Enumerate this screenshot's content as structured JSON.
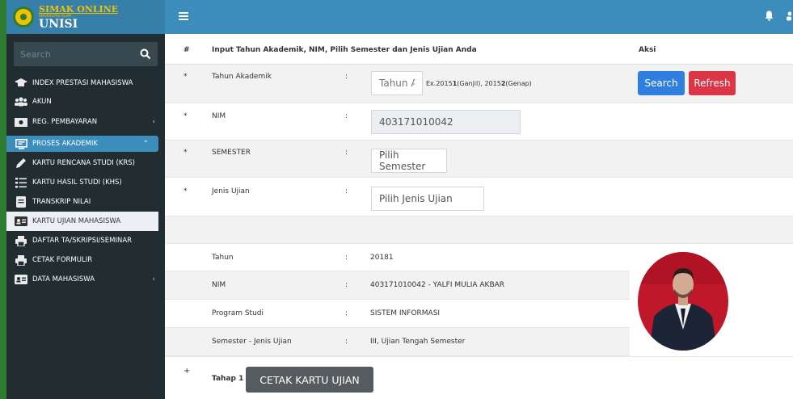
{
  "app": {
    "logo_top": "SIMAK ONLINE",
    "logo_subtitle": "UNIVERSITAS ISLAM ...",
    "logo_bottom": "UNISI"
  },
  "sidebar": {
    "search_placeholder": "Search",
    "items": [
      {
        "label": "INDEX PRESTASI MAHASISWA",
        "icon": "graduation-cap-icon"
      },
      {
        "label": "AKUN",
        "icon": "users-icon"
      },
      {
        "label": "REG. PEMBAYARAN",
        "icon": "money-icon",
        "arrow": "‹"
      },
      {
        "label": "PROSES AKADEMIK",
        "icon": "monitor-icon",
        "arrow": "⌄"
      }
    ],
    "submenu": [
      {
        "label": "KARTU RENCANA STUDI (KRS)",
        "icon": "pencil-icon"
      },
      {
        "label": "KARTU HASIL STUDI (KHS)",
        "icon": "list-icon"
      },
      {
        "label": "TRANSKRIP NILAI",
        "icon": "document-icon"
      },
      {
        "label": "KARTU UJIAN MAHASISWA",
        "icon": "id-card-icon"
      },
      {
        "label": "DAFTAR TA/SKRIPSI/SEMINAR",
        "icon": "printer-icon"
      },
      {
        "label": "CETAK FORMULIR",
        "icon": "printer-icon"
      }
    ],
    "last": {
      "label": "DATA MAHASISWA",
      "icon": "id-card-icon",
      "arrow": "‹"
    }
  },
  "table": {
    "header": {
      "num": "#",
      "title": "Input Tahun Akademik, NIM, Pilih Semester dan Jenis Ujian Anda",
      "action": "Aksi"
    },
    "rows": {
      "tahun_akademik": {
        "marker": "*",
        "label": "Tahun Akademik",
        "sep": ":",
        "placeholder": "Tahun Ak"
      },
      "nim": {
        "marker": "*",
        "label": "NIM",
        "sep": ":",
        "value": "403171010042"
      },
      "semester": {
        "marker": "*",
        "label": "SEMESTER",
        "sep": ":",
        "value": "Pilih Semester"
      },
      "jenis_ujian": {
        "marker": "*",
        "label": "Jenis Ujian",
        "sep": ":",
        "value": "Pilih Jenis Ujian"
      }
    },
    "hint": {
      "pre": "Ex.2015",
      "b1": "1",
      "mid": "(Ganjil), 2015",
      "b2": "2",
      "post": "(Genap)"
    },
    "buttons": {
      "search": "Search",
      "refresh": "Refresh"
    },
    "info": [
      {
        "label": "Tahun",
        "sep": ":",
        "value": "20181"
      },
      {
        "label": "NIM",
        "sep": ":",
        "value": "403171010042 - YALFI MULIA AKBAR"
      },
      {
        "label": "Program Studi",
        "sep": ":",
        "value": "SISTEM INFORMASI"
      },
      {
        "label": "Semester - Jenis Ujian",
        "sep": ":",
        "value": "III, Ujian Tengah Semester"
      }
    ],
    "step": {
      "marker": "+",
      "label": "Tahap 1",
      "button": "CETAK KARTU UJIAN"
    }
  },
  "colors": {
    "topbar": "#3c8dbc",
    "sidebar": "#222d32",
    "active": "#3c8dbc",
    "search_button": "#2f7fe0",
    "refresh_button": "#dc3545",
    "print_button": "#555b5f"
  }
}
